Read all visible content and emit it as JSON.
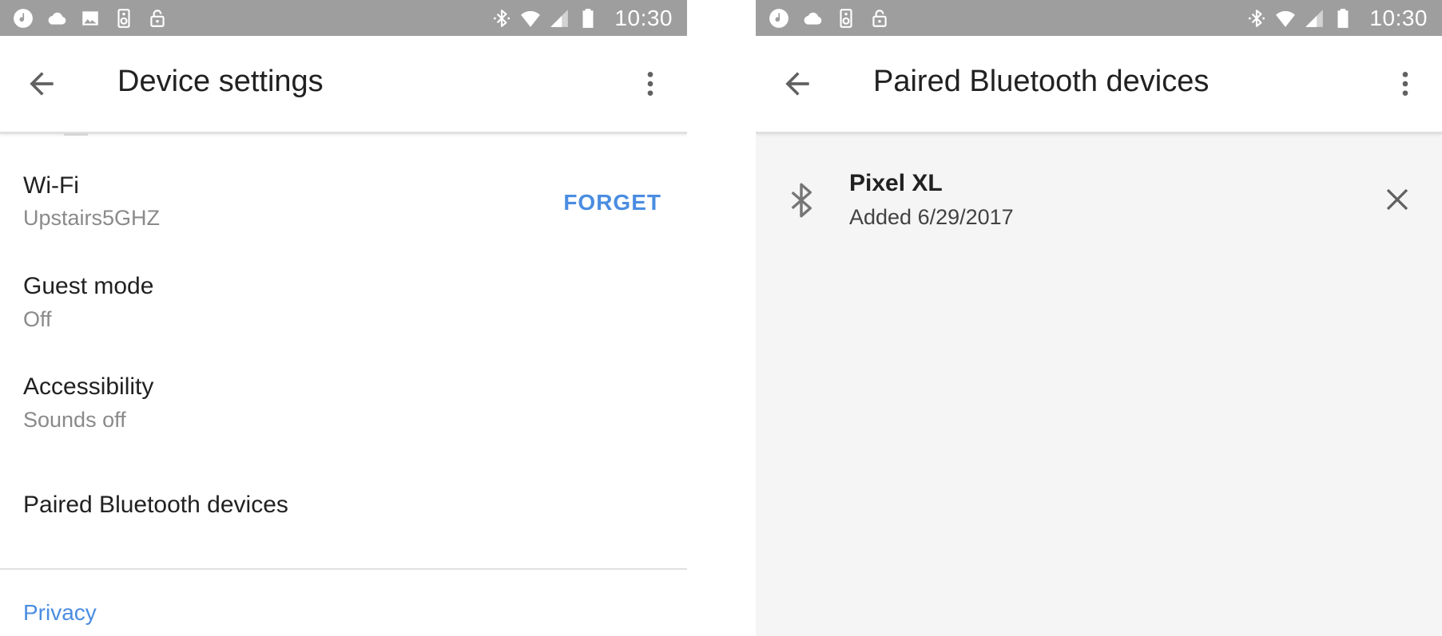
{
  "colors": {
    "status_bar": "#9e9e9e",
    "accent": "#4a8de1",
    "primary_text": "#212121",
    "secondary_text": "#8a8a8a",
    "right_screen_bg": "#f5f5f5"
  },
  "left_screen": {
    "status_bar": {
      "time": "10:30",
      "left_icons": [
        "music-icon",
        "cloud-icon",
        "image-icon",
        "speaker-icon",
        "lock-icon"
      ],
      "right_icons": [
        "bluetooth-icon",
        "wifi-icon",
        "cell-signal-icon",
        "battery-icon"
      ]
    },
    "app_bar": {
      "title": "Device settings",
      "back_icon": "arrow-back-icon",
      "menu_icon": "more-vert-icon"
    },
    "settings": [
      {
        "title": "Wi-Fi",
        "subtitle": "Upstairs5GHZ",
        "action": "FORGET"
      },
      {
        "title": "Guest mode",
        "subtitle": "Off"
      },
      {
        "title": "Accessibility",
        "subtitle": "Sounds off"
      },
      {
        "title": "Paired Bluetooth devices"
      }
    ],
    "section_header": "Privacy"
  },
  "right_screen": {
    "status_bar": {
      "time": "10:30",
      "left_icons": [
        "music-icon",
        "cloud-icon",
        "speaker-icon",
        "lock-icon"
      ],
      "right_icons": [
        "bluetooth-icon",
        "wifi-icon",
        "cell-signal-icon",
        "battery-icon"
      ]
    },
    "app_bar": {
      "title": "Paired Bluetooth devices",
      "back_icon": "arrow-back-icon",
      "menu_icon": "more-vert-icon"
    },
    "devices": [
      {
        "name": "Pixel XL",
        "added": "Added 6/29/2017",
        "icon": "bluetooth-icon",
        "remove_icon": "close-icon"
      }
    ]
  }
}
